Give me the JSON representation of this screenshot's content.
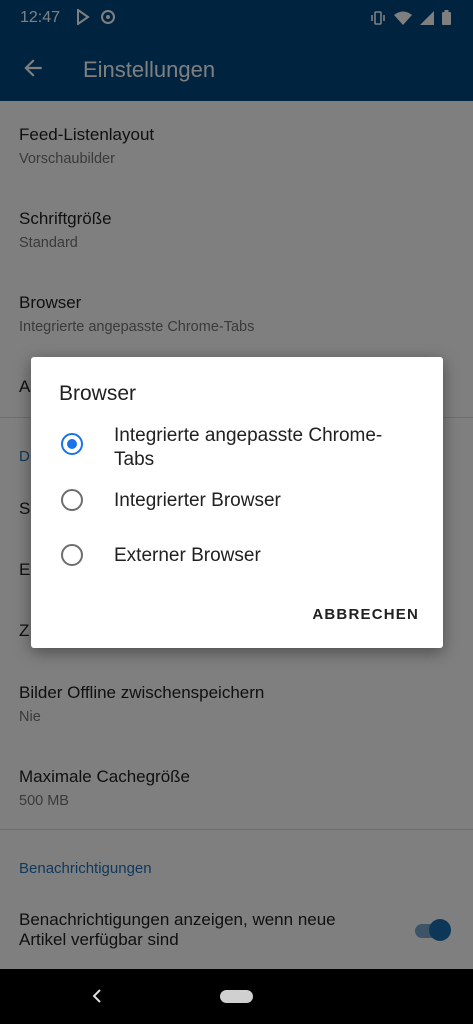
{
  "status_bar": {
    "time": "12:47"
  },
  "app_bar": {
    "title": "Einstellungen"
  },
  "preferences": [
    {
      "title": "Feed-Listenlayout",
      "summary": "Vorschaubilder"
    },
    {
      "title": "Schriftgröße",
      "summary": "Standard"
    },
    {
      "title": "Browser",
      "summary": "Integrierte angepasste Chrome-Tabs"
    }
  ],
  "partial_items": {
    "a": "A",
    "d": "D",
    "s": "S",
    "e": "E",
    "z": "Z"
  },
  "cache_prefs": [
    {
      "title": "Bilder Offline zwischenspeichern",
      "summary": "Nie"
    },
    {
      "title": "Maximale Cachegröße",
      "summary": "500 MB"
    }
  ],
  "notifications": {
    "category": "Benachrichtigungen",
    "pref_title": "Benachrichtigungen anzeigen, wenn neue Artikel verfügbar sind",
    "enabled": true
  },
  "dialog": {
    "title": "Browser",
    "options": [
      {
        "label": "Integrierte angepasste Chrome-Tabs",
        "checked": true
      },
      {
        "label": "Integrierter Browser",
        "checked": false
      },
      {
        "label": "Externer Browser",
        "checked": false
      }
    ],
    "cancel_label": "ABBRECHEN"
  },
  "colors": {
    "primary": "#00487e",
    "accent": "#1a73e8",
    "category": "#1e72b8"
  }
}
